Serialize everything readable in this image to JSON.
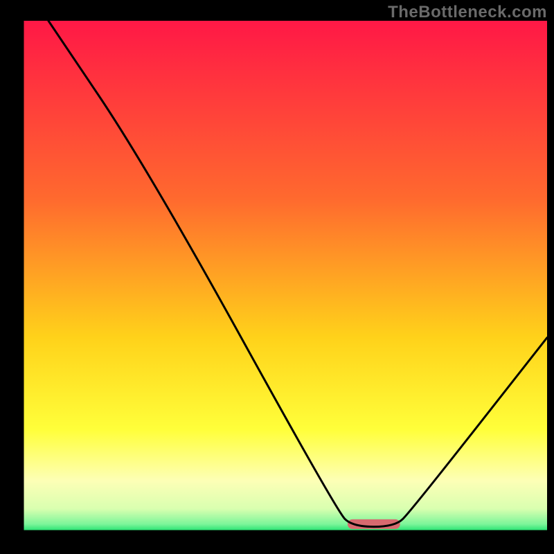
{
  "watermark": "TheBottleneck.com",
  "chart_data": {
    "type": "line",
    "title": "",
    "xlabel": "",
    "ylabel": "",
    "xlim": [
      0,
      100
    ],
    "ylim": [
      0,
      100
    ],
    "gradient_stops": [
      {
        "offset": 0,
        "color": "#ff1846"
      },
      {
        "offset": 0.35,
        "color": "#ff6a2e"
      },
      {
        "offset": 0.62,
        "color": "#ffd21a"
      },
      {
        "offset": 0.8,
        "color": "#ffff3a"
      },
      {
        "offset": 0.9,
        "color": "#fdffb6"
      },
      {
        "offset": 0.955,
        "color": "#d9ffb0"
      },
      {
        "offset": 0.985,
        "color": "#7cf59a"
      },
      {
        "offset": 1.0,
        "color": "#16e06a"
      }
    ],
    "series": [
      {
        "name": "bottleneck-curve",
        "points": [
          {
            "x": 5,
            "y": 100
          },
          {
            "x": 24,
            "y": 71
          },
          {
            "x": 60,
            "y": 4
          },
          {
            "x": 63,
            "y": 1
          },
          {
            "x": 71,
            "y": 1
          },
          {
            "x": 74,
            "y": 4
          },
          {
            "x": 100,
            "y": 38
          }
        ]
      }
    ],
    "marker": {
      "name": "sweet-spot-pill",
      "x_start": 62,
      "x_end": 72,
      "y": 1.5,
      "color": "#d76a6f"
    },
    "axes_color": "#000000"
  }
}
